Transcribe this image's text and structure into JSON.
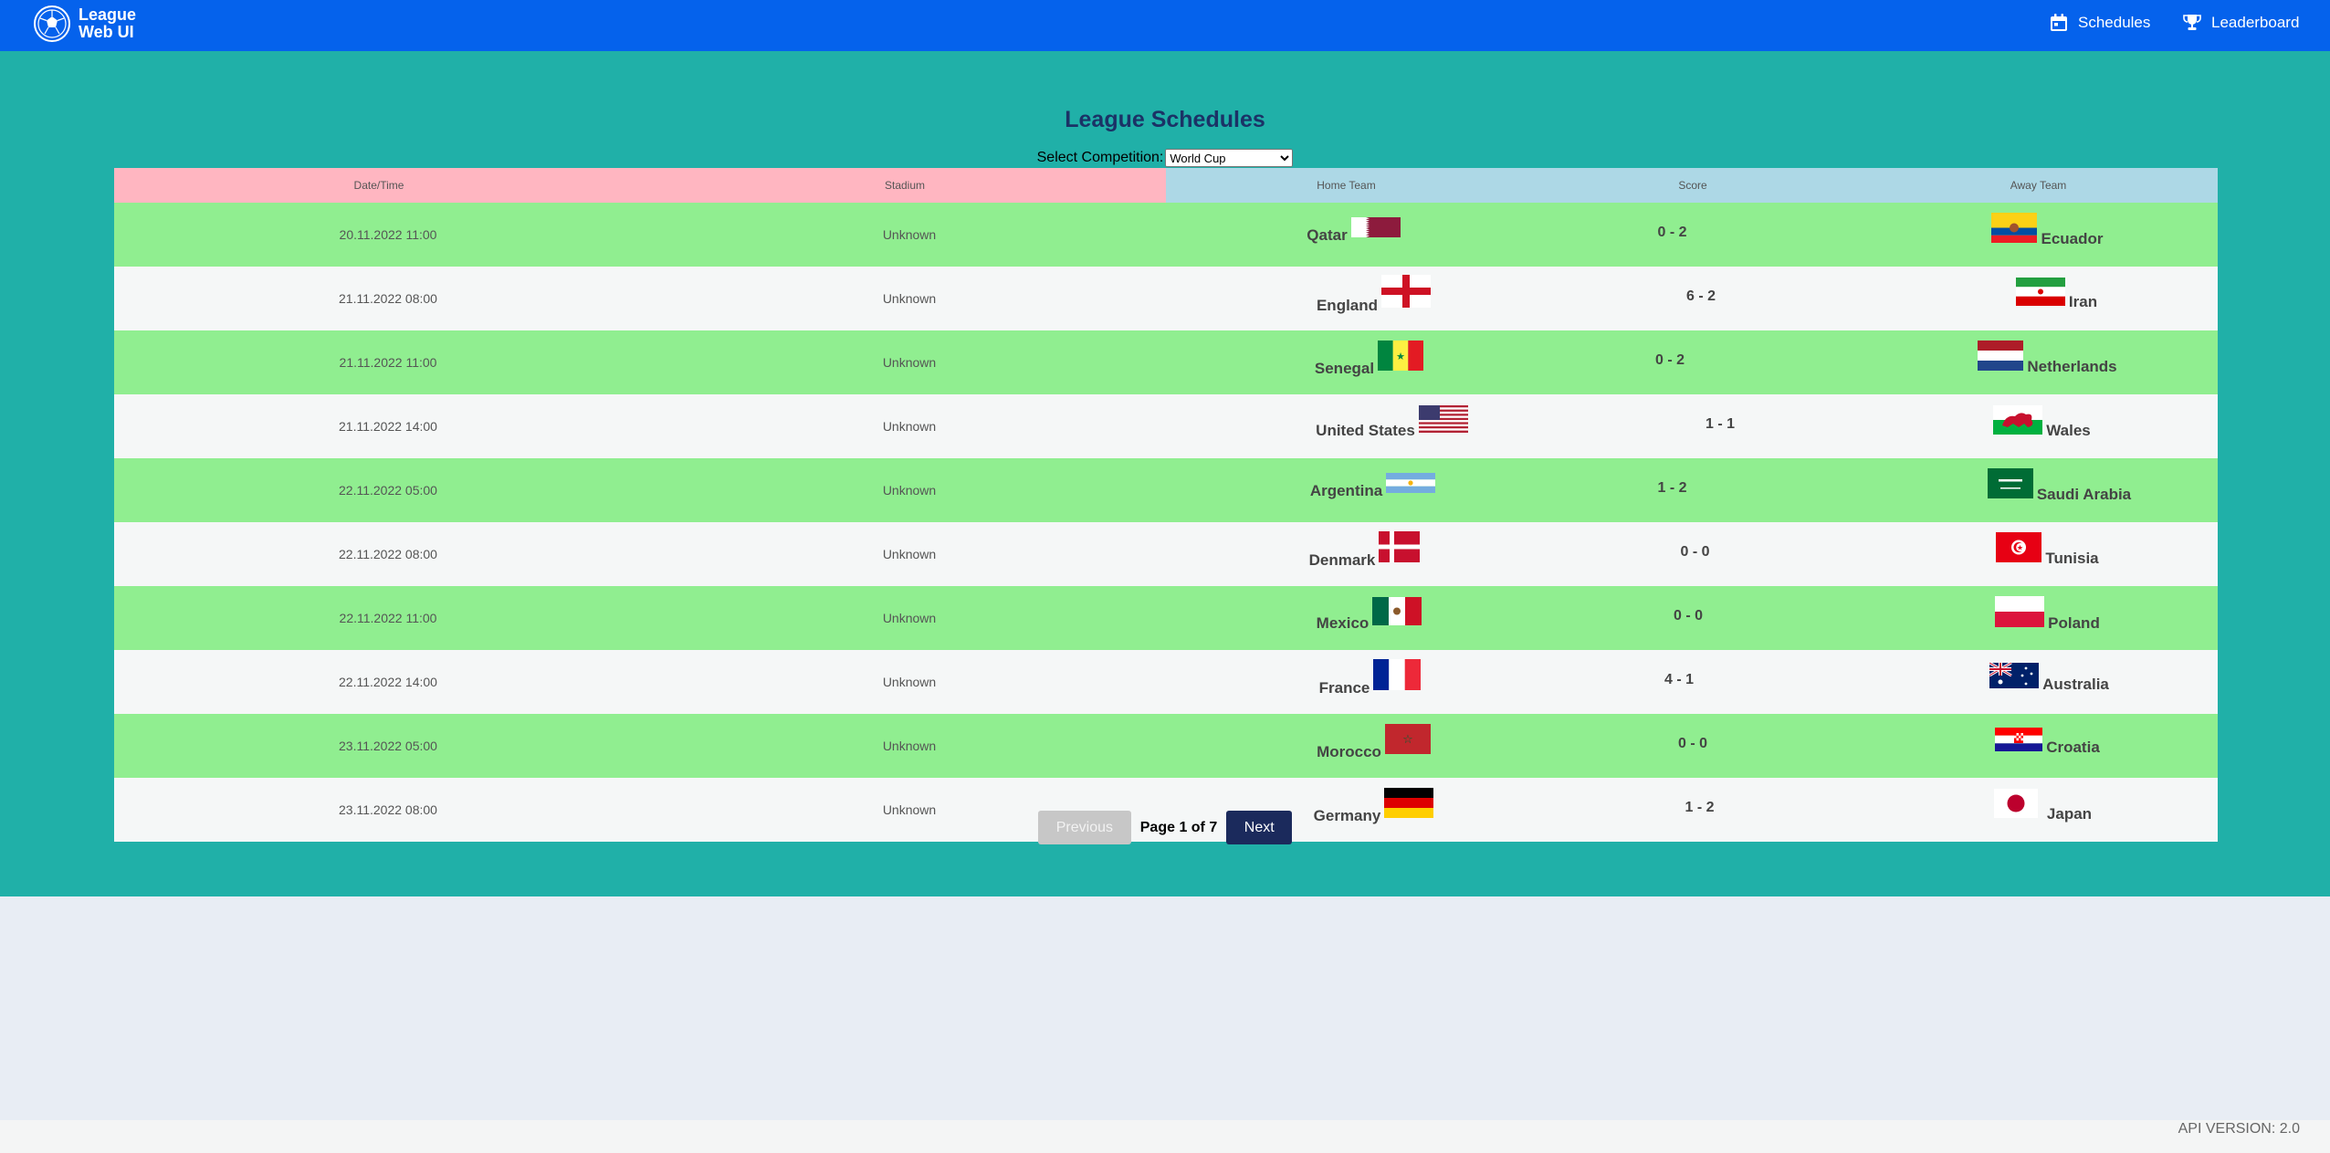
{
  "header": {
    "brand_line1": "League",
    "brand_line2": "Web UI",
    "nav": {
      "schedules": "Schedules",
      "leaderboard": "Leaderboard"
    }
  },
  "page": {
    "title": "League Schedules",
    "competition_label": "Select Competition:",
    "competition_selected": "World Cup"
  },
  "table": {
    "headers": {
      "datetime": "Date/Time",
      "stadium": "Stadium",
      "home": "Home Team",
      "score": "Score",
      "away": "Away Team"
    },
    "rows": [
      {
        "datetime": "20.11.2022 11:00",
        "stadium": "Unknown",
        "home": "Qatar",
        "score": "0 - 2",
        "away": "Ecuador"
      },
      {
        "datetime": "21.11.2022 08:00",
        "stadium": "Unknown",
        "home": "England",
        "score": "6 - 2",
        "away": "Iran"
      },
      {
        "datetime": "21.11.2022 11:00",
        "stadium": "Unknown",
        "home": "Senegal",
        "score": "0 - 2",
        "away": "Netherlands"
      },
      {
        "datetime": "21.11.2022 14:00",
        "stadium": "Unknown",
        "home": "United States",
        "score": "1 - 1",
        "away": "Wales"
      },
      {
        "datetime": "22.11.2022 05:00",
        "stadium": "Unknown",
        "home": "Argentina",
        "score": "1 - 2",
        "away": "Saudi Arabia"
      },
      {
        "datetime": "22.11.2022 08:00",
        "stadium": "Unknown",
        "home": "Denmark",
        "score": "0 - 0",
        "away": "Tunisia"
      },
      {
        "datetime": "22.11.2022 11:00",
        "stadium": "Unknown",
        "home": "Mexico",
        "score": "0 - 0",
        "away": "Poland"
      },
      {
        "datetime": "22.11.2022 14:00",
        "stadium": "Unknown",
        "home": "France",
        "score": "4 - 1",
        "away": "Australia"
      },
      {
        "datetime": "23.11.2022 05:00",
        "stadium": "Unknown",
        "home": "Morocco",
        "score": "0 - 0",
        "away": "Croatia"
      },
      {
        "datetime": "23.11.2022 08:00",
        "stadium": "Unknown",
        "home": "Germany",
        "score": "1 - 2",
        "away": "Japan"
      }
    ]
  },
  "pagination": {
    "previous": "Previous",
    "info": "Page 1 of 7",
    "next": "Next"
  },
  "footer": {
    "api_version": "API VERSION: 2.0"
  },
  "colors": {
    "header_bg": "#0562ec",
    "main_bg": "#20b0a8",
    "row_green": "#90ee90",
    "header_pink": "#ffb6c1",
    "header_blue": "#add8e6",
    "next_button": "#1b2a5c"
  }
}
